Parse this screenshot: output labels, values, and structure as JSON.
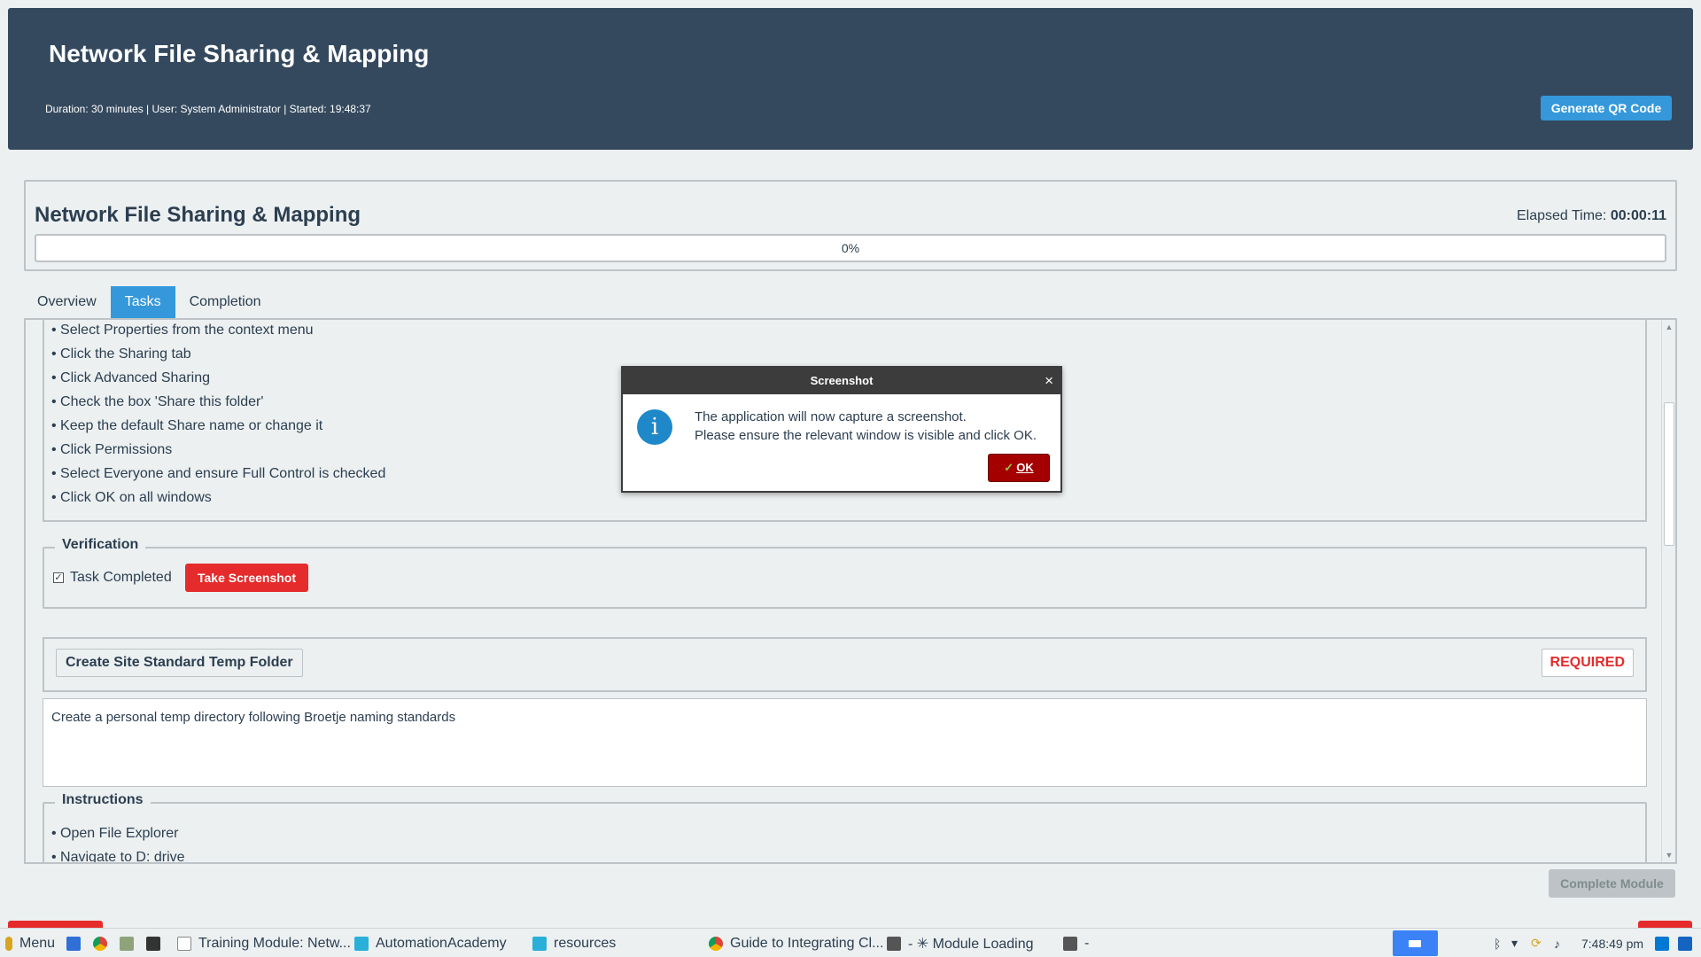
{
  "header": {
    "title": "Network File Sharing & Mapping",
    "meta": "Duration: 30 minutes | User: System Administrator | Started: 19:48:37",
    "qr_button": "Generate QR Code"
  },
  "module": {
    "title": "Network File Sharing & Mapping",
    "elapsed_label": "Elapsed Time:",
    "elapsed_value": "00:00:11",
    "progress_text": "0%",
    "progress_value": 0
  },
  "tabs": [
    "Overview",
    "Tasks",
    "Completion"
  ],
  "task1": {
    "steps": [
      "• Select Properties from the context menu",
      "• Click the Sharing tab",
      "• Click Advanced Sharing",
      "• Check the box 'Share this folder'",
      "• Keep the default Share name or change it",
      "• Click Permissions",
      "• Select Everyone and ensure Full Control is checked",
      "• Click OK on all windows"
    ],
    "verification_legend": "Verification",
    "checkbox_mark": "✓",
    "task_completed_label": "Task Completed",
    "take_screenshot": "Take Screenshot"
  },
  "task2": {
    "name": "Create Site Standard Temp Folder",
    "badge": "REQUIRED",
    "description": "Create a personal temp directory following Broetje naming standards",
    "instructions_legend": "Instructions",
    "steps": [
      "• Open File Explorer",
      "• Navigate to D: drive"
    ]
  },
  "complete_button": "Complete Module",
  "dialog": {
    "title": "Screenshot",
    "close": "×",
    "icon": "i",
    "line1": "The application will now capture a screenshot.",
    "line2": "Please ensure the relevant window is visible and click OK.",
    "ok_check": "✓",
    "ok_label": "OK"
  },
  "taskbar": {
    "menu": "Menu",
    "windows": [
      "Training Module: Netw...",
      "AutomationAcademy",
      "resources",
      "Guide to Integrating Cl...",
      "- ✳ Module Loading",
      "-"
    ],
    "clock": "7:48:49 pm"
  },
  "colors": {
    "header_bg": "#34495e",
    "accent": "#3498db",
    "danger": "#e52b2b",
    "ok_button": "#a40000"
  }
}
